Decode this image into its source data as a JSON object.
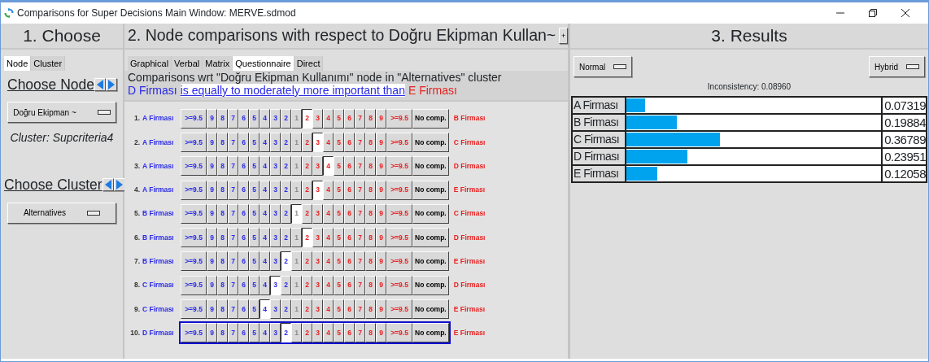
{
  "window": {
    "title": "Comparisons for Super Decisions Main Window: MERVE.sdmod"
  },
  "choose_panel": {
    "heading": "1. Choose",
    "tabs": [
      {
        "label": "Node",
        "selected": true
      },
      {
        "label": "Cluster",
        "selected": false
      }
    ],
    "node_label": "Choose Node",
    "node_dropdown": "Doğru Ekipman ~",
    "cluster_info": "Cluster: Supcriteria4",
    "cluster_label": "Choose Cluster",
    "cluster_dropdown": "Alternatives"
  },
  "comparisons_panel": {
    "heading": "2. Node comparisons with respect to Doğru Ekipman Kullan~",
    "expand_button": "+",
    "tabs": [
      {
        "label": "Graphical",
        "selected": false
      },
      {
        "label": "Verbal",
        "selected": false
      },
      {
        "label": "Matrix",
        "selected": false
      },
      {
        "label": "Questionnaire",
        "selected": true
      },
      {
        "label": "Direct",
        "selected": false
      }
    ],
    "description": "Comparisons wrt \"Doğru Ekipman Kullanımı\" node in \"Alternatives\" cluster",
    "verdict": {
      "subject": "D Firması",
      "relation": "is equally to moderately more important than",
      "object": "E Firması"
    },
    "rows": [
      {
        "number": "1.",
        "left": "A Firması",
        "right": "B Firması",
        "focused": false,
        "cells": [
          {
            "label": ">=9.5",
            "kind": "left",
            "selected": false
          },
          {
            "label": "9",
            "kind": "left",
            "selected": false
          },
          {
            "label": "8",
            "kind": "left",
            "selected": false
          },
          {
            "label": "7",
            "kind": "left",
            "selected": false
          },
          {
            "label": "6",
            "kind": "left",
            "selected": false
          },
          {
            "label": "5",
            "kind": "left",
            "selected": false
          },
          {
            "label": "4",
            "kind": "left",
            "selected": false
          },
          {
            "label": "3",
            "kind": "left",
            "selected": false
          },
          {
            "label": "2",
            "kind": "left",
            "selected": false
          },
          {
            "label": "1",
            "kind": "equal",
            "selected": false
          },
          {
            "label": "2",
            "kind": "right",
            "selected": true
          },
          {
            "label": "3",
            "kind": "right",
            "selected": false
          },
          {
            "label": "4",
            "kind": "right",
            "selected": false
          },
          {
            "label": "5",
            "kind": "right",
            "selected": false
          },
          {
            "label": "6",
            "kind": "right",
            "selected": false
          },
          {
            "label": "7",
            "kind": "right",
            "selected": false
          },
          {
            "label": "8",
            "kind": "right",
            "selected": false
          },
          {
            "label": "9",
            "kind": "right",
            "selected": false
          },
          {
            "label": ">=9.5",
            "kind": "right",
            "selected": false
          },
          {
            "label": "No comp.",
            "kind": "none",
            "selected": false
          }
        ]
      },
      {
        "number": "2.",
        "left": "A Firması",
        "right": "C Firması",
        "focused": false,
        "cells": [
          {
            "label": ">=9.5",
            "kind": "left",
            "selected": false
          },
          {
            "label": "9",
            "kind": "left",
            "selected": false
          },
          {
            "label": "8",
            "kind": "left",
            "selected": false
          },
          {
            "label": "7",
            "kind": "left",
            "selected": false
          },
          {
            "label": "6",
            "kind": "left",
            "selected": false
          },
          {
            "label": "5",
            "kind": "left",
            "selected": false
          },
          {
            "label": "4",
            "kind": "left",
            "selected": false
          },
          {
            "label": "3",
            "kind": "left",
            "selected": false
          },
          {
            "label": "2",
            "kind": "left",
            "selected": false
          },
          {
            "label": "1",
            "kind": "equal",
            "selected": false
          },
          {
            "label": "2",
            "kind": "right",
            "selected": false
          },
          {
            "label": "3",
            "kind": "right",
            "selected": true
          },
          {
            "label": "4",
            "kind": "right",
            "selected": false
          },
          {
            "label": "5",
            "kind": "right",
            "selected": false
          },
          {
            "label": "6",
            "kind": "right",
            "selected": false
          },
          {
            "label": "7",
            "kind": "right",
            "selected": false
          },
          {
            "label": "8",
            "kind": "right",
            "selected": false
          },
          {
            "label": "9",
            "kind": "right",
            "selected": false
          },
          {
            "label": ">=9.5",
            "kind": "right",
            "selected": false
          },
          {
            "label": "No comp.",
            "kind": "none",
            "selected": false
          }
        ]
      },
      {
        "number": "3.",
        "left": "A Firması",
        "right": "D Firması",
        "focused": false,
        "cells": [
          {
            "label": ">=9.5",
            "kind": "left",
            "selected": false
          },
          {
            "label": "9",
            "kind": "left",
            "selected": false
          },
          {
            "label": "8",
            "kind": "left",
            "selected": false
          },
          {
            "label": "7",
            "kind": "left",
            "selected": false
          },
          {
            "label": "6",
            "kind": "left",
            "selected": false
          },
          {
            "label": "5",
            "kind": "left",
            "selected": false
          },
          {
            "label": "4",
            "kind": "left",
            "selected": false
          },
          {
            "label": "3",
            "kind": "left",
            "selected": false
          },
          {
            "label": "2",
            "kind": "left",
            "selected": false
          },
          {
            "label": "1",
            "kind": "equal",
            "selected": false
          },
          {
            "label": "2",
            "kind": "right",
            "selected": false
          },
          {
            "label": "3",
            "kind": "right",
            "selected": false
          },
          {
            "label": "4",
            "kind": "right",
            "selected": true
          },
          {
            "label": "5",
            "kind": "right",
            "selected": false
          },
          {
            "label": "6",
            "kind": "right",
            "selected": false
          },
          {
            "label": "7",
            "kind": "right",
            "selected": false
          },
          {
            "label": "8",
            "kind": "right",
            "selected": false
          },
          {
            "label": "9",
            "kind": "right",
            "selected": false
          },
          {
            "label": ">=9.5",
            "kind": "right",
            "selected": false
          },
          {
            "label": "No comp.",
            "kind": "none",
            "selected": false
          }
        ]
      },
      {
        "number": "4.",
        "left": "A Firması",
        "right": "E Firması",
        "focused": false,
        "cells": [
          {
            "label": ">=9.5",
            "kind": "left",
            "selected": false
          },
          {
            "label": "9",
            "kind": "left",
            "selected": false
          },
          {
            "label": "8",
            "kind": "left",
            "selected": false
          },
          {
            "label": "7",
            "kind": "left",
            "selected": false
          },
          {
            "label": "6",
            "kind": "left",
            "selected": false
          },
          {
            "label": "5",
            "kind": "left",
            "selected": false
          },
          {
            "label": "4",
            "kind": "left",
            "selected": false
          },
          {
            "label": "3",
            "kind": "left",
            "selected": false
          },
          {
            "label": "2",
            "kind": "left",
            "selected": false
          },
          {
            "label": "1",
            "kind": "equal",
            "selected": false
          },
          {
            "label": "2",
            "kind": "right",
            "selected": false
          },
          {
            "label": "3",
            "kind": "right",
            "selected": true
          },
          {
            "label": "4",
            "kind": "right",
            "selected": false
          },
          {
            "label": "5",
            "kind": "right",
            "selected": false
          },
          {
            "label": "6",
            "kind": "right",
            "selected": false
          },
          {
            "label": "7",
            "kind": "right",
            "selected": false
          },
          {
            "label": "8",
            "kind": "right",
            "selected": false
          },
          {
            "label": "9",
            "kind": "right",
            "selected": false
          },
          {
            "label": ">=9.5",
            "kind": "right",
            "selected": false
          },
          {
            "label": "No comp.",
            "kind": "none",
            "selected": false
          }
        ]
      },
      {
        "number": "5.",
        "left": "B Firması",
        "right": "C Firması",
        "focused": false,
        "cells": [
          {
            "label": ">=9.5",
            "kind": "left",
            "selected": false
          },
          {
            "label": "9",
            "kind": "left",
            "selected": false
          },
          {
            "label": "8",
            "kind": "left",
            "selected": false
          },
          {
            "label": "7",
            "kind": "left",
            "selected": false
          },
          {
            "label": "6",
            "kind": "left",
            "selected": false
          },
          {
            "label": "5",
            "kind": "left",
            "selected": false
          },
          {
            "label": "4",
            "kind": "left",
            "selected": false
          },
          {
            "label": "3",
            "kind": "left",
            "selected": false
          },
          {
            "label": "2",
            "kind": "left",
            "selected": false
          },
          {
            "label": "1",
            "kind": "equal",
            "selected": true
          },
          {
            "label": "2",
            "kind": "right",
            "selected": false
          },
          {
            "label": "3",
            "kind": "right",
            "selected": false
          },
          {
            "label": "4",
            "kind": "right",
            "selected": false
          },
          {
            "label": "5",
            "kind": "right",
            "selected": false
          },
          {
            "label": "6",
            "kind": "right",
            "selected": false
          },
          {
            "label": "7",
            "kind": "right",
            "selected": false
          },
          {
            "label": "8",
            "kind": "right",
            "selected": false
          },
          {
            "label": "9",
            "kind": "right",
            "selected": false
          },
          {
            "label": ">=9.5",
            "kind": "right",
            "selected": false
          },
          {
            "label": "No comp.",
            "kind": "none",
            "selected": false
          }
        ]
      },
      {
        "number": "6.",
        "left": "B Firması",
        "right": "D Firması",
        "focused": false,
        "cells": [
          {
            "label": ">=9.5",
            "kind": "left",
            "selected": false
          },
          {
            "label": "9",
            "kind": "left",
            "selected": false
          },
          {
            "label": "8",
            "kind": "left",
            "selected": false
          },
          {
            "label": "7",
            "kind": "left",
            "selected": false
          },
          {
            "label": "6",
            "kind": "left",
            "selected": false
          },
          {
            "label": "5",
            "kind": "left",
            "selected": false
          },
          {
            "label": "4",
            "kind": "left",
            "selected": false
          },
          {
            "label": "3",
            "kind": "left",
            "selected": false
          },
          {
            "label": "2",
            "kind": "left",
            "selected": false
          },
          {
            "label": "1",
            "kind": "equal",
            "selected": false
          },
          {
            "label": "2",
            "kind": "right",
            "selected": true
          },
          {
            "label": "3",
            "kind": "right",
            "selected": false
          },
          {
            "label": "4",
            "kind": "right",
            "selected": false
          },
          {
            "label": "5",
            "kind": "right",
            "selected": false
          },
          {
            "label": "6",
            "kind": "right",
            "selected": false
          },
          {
            "label": "7",
            "kind": "right",
            "selected": false
          },
          {
            "label": "8",
            "kind": "right",
            "selected": false
          },
          {
            "label": "9",
            "kind": "right",
            "selected": false
          },
          {
            "label": ">=9.5",
            "kind": "right",
            "selected": false
          },
          {
            "label": "No comp.",
            "kind": "none",
            "selected": false
          }
        ]
      },
      {
        "number": "7.",
        "left": "B Firması",
        "right": "E Firması",
        "focused": false,
        "cells": [
          {
            "label": ">=9.5",
            "kind": "left",
            "selected": false
          },
          {
            "label": "9",
            "kind": "left",
            "selected": false
          },
          {
            "label": "8",
            "kind": "left",
            "selected": false
          },
          {
            "label": "7",
            "kind": "left",
            "selected": false
          },
          {
            "label": "6",
            "kind": "left",
            "selected": false
          },
          {
            "label": "5",
            "kind": "left",
            "selected": false
          },
          {
            "label": "4",
            "kind": "left",
            "selected": false
          },
          {
            "label": "3",
            "kind": "left",
            "selected": false
          },
          {
            "label": "2",
            "kind": "left",
            "selected": true
          },
          {
            "label": "1",
            "kind": "equal",
            "selected": false
          },
          {
            "label": "2",
            "kind": "right",
            "selected": false
          },
          {
            "label": "3",
            "kind": "right",
            "selected": false
          },
          {
            "label": "4",
            "kind": "right",
            "selected": false
          },
          {
            "label": "5",
            "kind": "right",
            "selected": false
          },
          {
            "label": "6",
            "kind": "right",
            "selected": false
          },
          {
            "label": "7",
            "kind": "right",
            "selected": false
          },
          {
            "label": "8",
            "kind": "right",
            "selected": false
          },
          {
            "label": "9",
            "kind": "right",
            "selected": false
          },
          {
            "label": ">=9.5",
            "kind": "right",
            "selected": false
          },
          {
            "label": "No comp.",
            "kind": "none",
            "selected": false
          }
        ]
      },
      {
        "number": "8.",
        "left": "C Firması",
        "right": "D Firması",
        "focused": false,
        "cells": [
          {
            "label": ">=9.5",
            "kind": "left",
            "selected": false
          },
          {
            "label": "9",
            "kind": "left",
            "selected": false
          },
          {
            "label": "8",
            "kind": "left",
            "selected": false
          },
          {
            "label": "7",
            "kind": "left",
            "selected": false
          },
          {
            "label": "6",
            "kind": "left",
            "selected": false
          },
          {
            "label": "5",
            "kind": "left",
            "selected": false
          },
          {
            "label": "4",
            "kind": "left",
            "selected": false
          },
          {
            "label": "3",
            "kind": "left",
            "selected": true
          },
          {
            "label": "2",
            "kind": "left",
            "selected": false
          },
          {
            "label": "1",
            "kind": "equal",
            "selected": false
          },
          {
            "label": "2",
            "kind": "right",
            "selected": false
          },
          {
            "label": "3",
            "kind": "right",
            "selected": false
          },
          {
            "label": "4",
            "kind": "right",
            "selected": false
          },
          {
            "label": "5",
            "kind": "right",
            "selected": false
          },
          {
            "label": "6",
            "kind": "right",
            "selected": false
          },
          {
            "label": "7",
            "kind": "right",
            "selected": false
          },
          {
            "label": "8",
            "kind": "right",
            "selected": false
          },
          {
            "label": "9",
            "kind": "right",
            "selected": false
          },
          {
            "label": ">=9.5",
            "kind": "right",
            "selected": false
          },
          {
            "label": "No comp.",
            "kind": "none",
            "selected": false
          }
        ]
      },
      {
        "number": "9.",
        "left": "C Firması",
        "right": "E Firması",
        "focused": false,
        "cells": [
          {
            "label": ">=9.5",
            "kind": "left",
            "selected": false
          },
          {
            "label": "9",
            "kind": "left",
            "selected": false
          },
          {
            "label": "8",
            "kind": "left",
            "selected": false
          },
          {
            "label": "7",
            "kind": "left",
            "selected": false
          },
          {
            "label": "6",
            "kind": "left",
            "selected": false
          },
          {
            "label": "5",
            "kind": "left",
            "selected": false
          },
          {
            "label": "4",
            "kind": "left",
            "selected": true
          },
          {
            "label": "3",
            "kind": "left",
            "selected": false
          },
          {
            "label": "2",
            "kind": "left",
            "selected": false
          },
          {
            "label": "1",
            "kind": "equal",
            "selected": false
          },
          {
            "label": "2",
            "kind": "right",
            "selected": false
          },
          {
            "label": "3",
            "kind": "right",
            "selected": false
          },
          {
            "label": "4",
            "kind": "right",
            "selected": false
          },
          {
            "label": "5",
            "kind": "right",
            "selected": false
          },
          {
            "label": "6",
            "kind": "right",
            "selected": false
          },
          {
            "label": "7",
            "kind": "right",
            "selected": false
          },
          {
            "label": "8",
            "kind": "right",
            "selected": false
          },
          {
            "label": "9",
            "kind": "right",
            "selected": false
          },
          {
            "label": ">=9.5",
            "kind": "right",
            "selected": false
          },
          {
            "label": "No comp.",
            "kind": "none",
            "selected": false
          }
        ]
      },
      {
        "number": "10.",
        "left": "D Firması",
        "right": "E Firması",
        "focused": true,
        "cells": [
          {
            "label": ">=9.5",
            "kind": "left",
            "selected": false
          },
          {
            "label": "9",
            "kind": "left",
            "selected": false
          },
          {
            "label": "8",
            "kind": "left",
            "selected": false
          },
          {
            "label": "7",
            "kind": "left",
            "selected": false
          },
          {
            "label": "6",
            "kind": "left",
            "selected": false
          },
          {
            "label": "5",
            "kind": "left",
            "selected": false
          },
          {
            "label": "4",
            "kind": "left",
            "selected": false
          },
          {
            "label": "3",
            "kind": "left",
            "selected": false
          },
          {
            "label": "2",
            "kind": "left",
            "selected": true
          },
          {
            "label": "1",
            "kind": "equal",
            "selected": false
          },
          {
            "label": "2",
            "kind": "right",
            "selected": false
          },
          {
            "label": "3",
            "kind": "right",
            "selected": false
          },
          {
            "label": "4",
            "kind": "right",
            "selected": false
          },
          {
            "label": "5",
            "kind": "right",
            "selected": false
          },
          {
            "label": "6",
            "kind": "right",
            "selected": false
          },
          {
            "label": "7",
            "kind": "right",
            "selected": false
          },
          {
            "label": "8",
            "kind": "right",
            "selected": false
          },
          {
            "label": "9",
            "kind": "right",
            "selected": false
          },
          {
            "label": ">=9.5",
            "kind": "right",
            "selected": false
          },
          {
            "label": "No comp.",
            "kind": "none",
            "selected": false
          }
        ]
      }
    ]
  },
  "results_panel": {
    "heading": "3. Results",
    "mode_dropdown": "Normal",
    "method_dropdown": "Hybrid",
    "inconsistency": "Inconsistency: 0.08960",
    "rows": [
      {
        "name": "A Firması",
        "level": 0.07319,
        "value": "0.07319"
      },
      {
        "name": "B Firması",
        "level": 0.19884,
        "value": "0.19884"
      },
      {
        "name": "C Firması",
        "level": 0.36789,
        "value": "0.36789"
      },
      {
        "name": "D Firması",
        "level": 0.23951,
        "value": "0.23951"
      },
      {
        "name": "E Firması",
        "level": 0.12058,
        "value": "0.12058"
      }
    ]
  }
}
